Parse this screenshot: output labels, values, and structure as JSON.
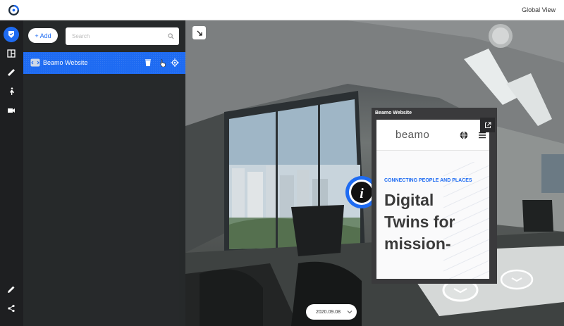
{
  "app": {
    "view_label": "Global View"
  },
  "sidebar": {
    "items": [
      {
        "icon": "tag-icon",
        "active": true
      },
      {
        "icon": "floorplan-icon"
      },
      {
        "icon": "ruler-icon"
      },
      {
        "icon": "walk-icon"
      },
      {
        "icon": "video-icon"
      }
    ],
    "bottom_items": [
      {
        "icon": "pencil-icon"
      },
      {
        "icon": "share-icon"
      }
    ]
  },
  "panel": {
    "add_label": "+ Add",
    "search_placeholder": "Search",
    "list": [
      {
        "label": "Beamo Website",
        "type": "embed"
      }
    ]
  },
  "popup": {
    "title": "Beamo Website",
    "site": {
      "brand": "beamo",
      "tagline": "CONNECTING PEOPLE AND PLACES",
      "headline": "Digital Twins for mission-"
    }
  },
  "scene": {
    "date": "2020.09.08"
  },
  "colors": {
    "accent": "#1e6bf2"
  }
}
